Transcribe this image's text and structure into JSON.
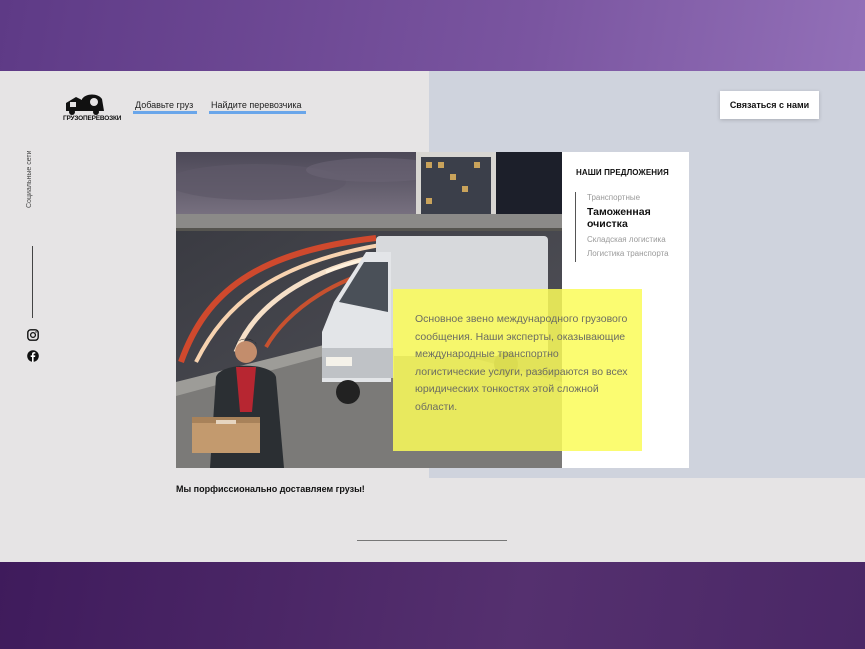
{
  "brand": {
    "logo_text": "ГРУЗОПЕРЕВОЗКИ"
  },
  "nav": {
    "items": [
      {
        "label": "Добавьте груз"
      },
      {
        "label": "Найдите перевозчика"
      }
    ],
    "contact_label": "Связаться с нами"
  },
  "social": {
    "label": "Социальные сети",
    "icons": [
      "instagram-icon",
      "facebook-icon"
    ]
  },
  "offers": {
    "title": "НАШИ ПРЕДЛОЖЕНИЯ",
    "items": [
      {
        "label": "Транспортные",
        "active": false
      },
      {
        "label": "Таможенная очистка",
        "active": true
      },
      {
        "label": "Складская логистика",
        "active": false
      },
      {
        "label": "Логистика транспорта",
        "active": false
      }
    ]
  },
  "hero": {
    "description": "Основное звено международного грузового сообщения. Наши эксперты, оказывающие международные транспортно логистические услуги, разбираются во всех юридических тонкостях этой сложной области."
  },
  "tagline": "Мы порфиссионально доставляем грузы!",
  "colors": {
    "accent_underline": "#6aa6ea",
    "highlight_yellow": "#fafc5a",
    "background_purple": "#6b4592"
  }
}
